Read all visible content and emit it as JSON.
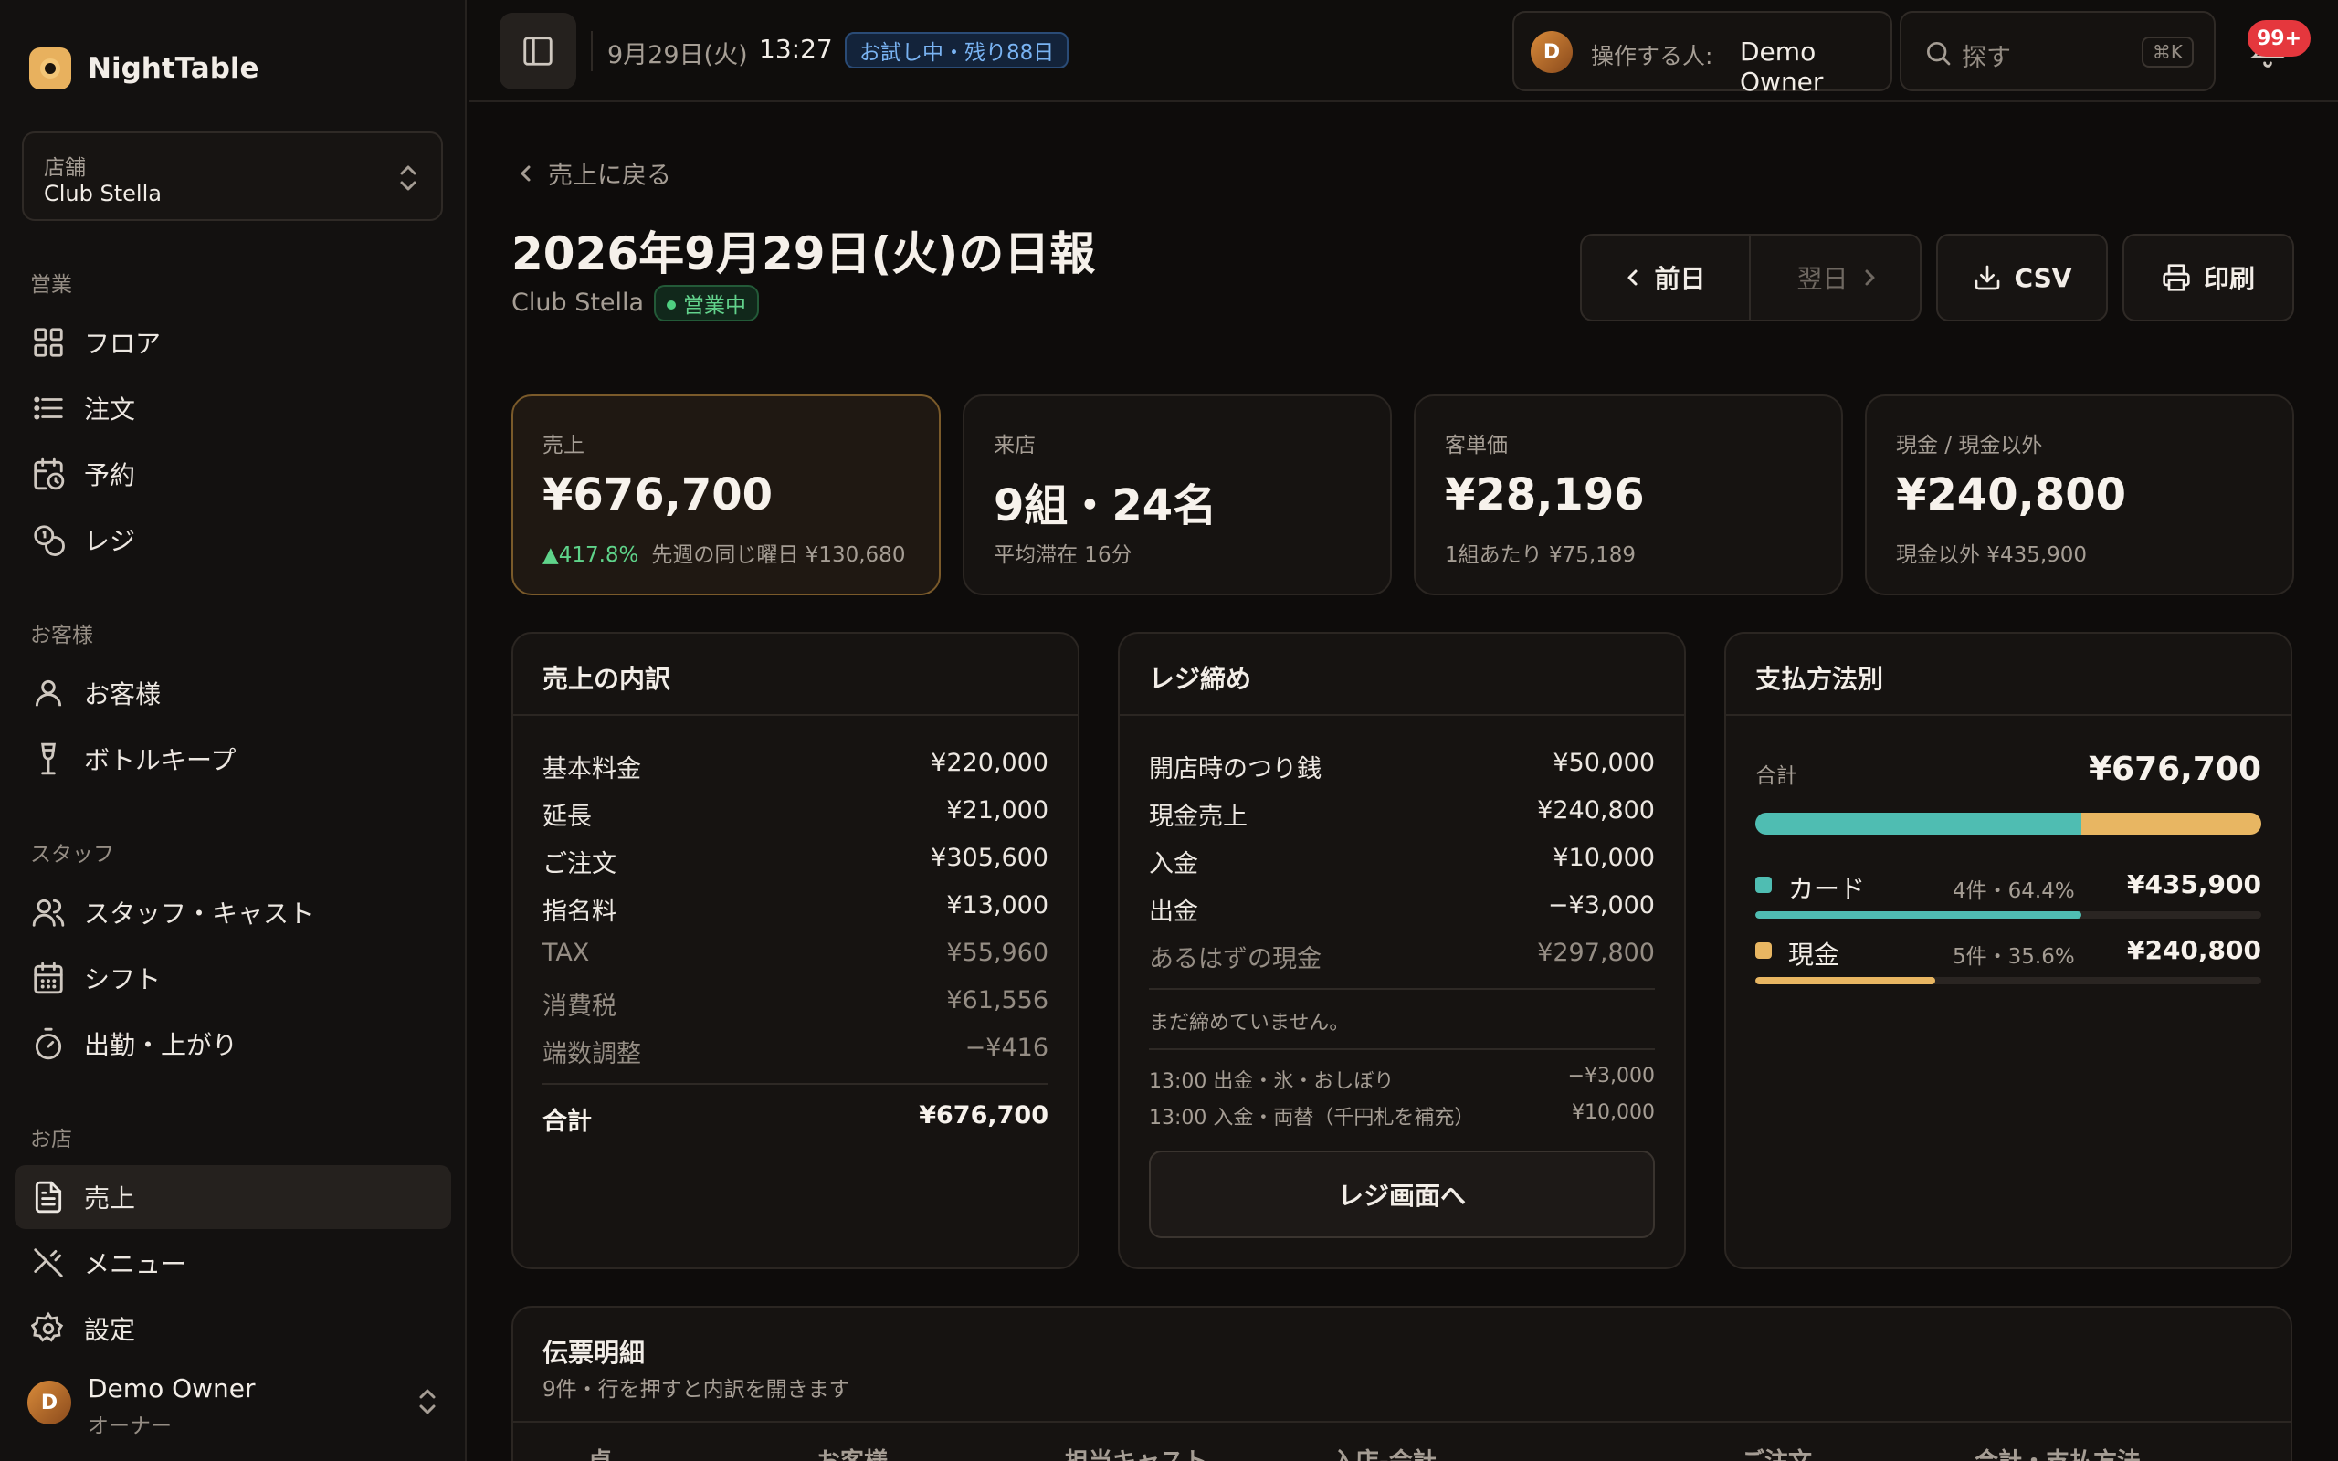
{
  "app": {
    "name": "NightTable"
  },
  "store": {
    "label": "店舗",
    "value": "Club Stella"
  },
  "nav": {
    "sections": {
      "business": "営業",
      "customers": "お客様",
      "staff": "スタッフ",
      "shop": "お店"
    },
    "items": [
      {
        "label": "フロア",
        "icon": "grid-icon"
      },
      {
        "label": "注文",
        "icon": "list-icon"
      },
      {
        "label": "予約",
        "icon": "calendar-clock-icon"
      },
      {
        "label": "レジ",
        "icon": "coins-icon"
      },
      {
        "label": "お客様",
        "icon": "user-icon"
      },
      {
        "label": "ボトルキープ",
        "icon": "wine-glass-icon"
      },
      {
        "label": "スタッフ・キャスト",
        "icon": "users-icon"
      },
      {
        "label": "シフト",
        "icon": "calendar-icon"
      },
      {
        "label": "出勤・上がり",
        "icon": "timer-icon"
      },
      {
        "label": "売上",
        "icon": "document-icon",
        "active": true
      },
      {
        "label": "メニュー",
        "icon": "utensils-icon"
      },
      {
        "label": "設定",
        "icon": "gear-icon"
      }
    ]
  },
  "user": {
    "initial": "D",
    "name": "Demo Owner",
    "role": "オーナー"
  },
  "topbar": {
    "date": "9月29日(火)",
    "time": "13:27",
    "trial": "お試し中・残り88日",
    "operator_label": "操作する人:",
    "operator_name": "Demo Owner",
    "operator_initial": "D",
    "search_placeholder": "探す",
    "search_shortcut": "⌘K",
    "notifications": "99+"
  },
  "page": {
    "back": "売上に戻る",
    "title": "2026年9月29日(火)の日報",
    "store": "Club Stella",
    "status": "営業中",
    "prev": "前日",
    "next": "翌日",
    "csv": "CSV",
    "print": "印刷"
  },
  "kpis": {
    "sales": {
      "label": "売上",
      "value": "¥676,700",
      "change": "▲417.8%",
      "compare": "先週の同じ曜日 ¥130,680"
    },
    "visits": {
      "label": "来店",
      "value": "9組・24名",
      "sub": "平均滞在 16分"
    },
    "avg": {
      "label": "客単価",
      "value": "¥28,196",
      "sub": "1組あたり ¥75,189"
    },
    "cash": {
      "label": "現金 / 現金以外",
      "value": "¥240,800",
      "sub": "現金以外 ¥435,900"
    }
  },
  "breakdown": {
    "title": "売上の内訳",
    "rows": [
      {
        "k": "基本料金",
        "v": "¥220,000"
      },
      {
        "k": "延長",
        "v": "¥21,000"
      },
      {
        "k": "ご注文",
        "v": "¥305,600"
      },
      {
        "k": "指名料",
        "v": "¥13,000"
      },
      {
        "k": "TAX",
        "v": "¥55,960"
      },
      {
        "k": "消費税",
        "v": "¥61,556"
      },
      {
        "k": "端数調整",
        "v": "−¥416"
      }
    ],
    "total_label": "合計",
    "total_value": "¥676,700"
  },
  "register": {
    "title": "レジ締め",
    "rows": [
      {
        "k": "開店時のつり銭",
        "v": "¥50,000"
      },
      {
        "k": "現金売上",
        "v": "¥240,800"
      },
      {
        "k": "入金",
        "v": "¥10,000"
      },
      {
        "k": "出金",
        "v": "−¥3,000"
      },
      {
        "k": "あるはずの現金",
        "v": "¥297,800"
      }
    ],
    "note": "まだ締めていません。",
    "log": [
      {
        "k": "13:00 出金・氷・おしぼり",
        "v": "−¥3,000"
      },
      {
        "k": "13:00 入金・両替（千円札を補充）",
        "v": "¥10,000"
      }
    ],
    "button": "レジ画面へ"
  },
  "payments": {
    "title": "支払方法別",
    "total_label": "合計",
    "total_value": "¥676,700",
    "methods": [
      {
        "name": "カード",
        "meta": "4件・64.4%",
        "amount": "¥435,900",
        "share": 0.644,
        "color": "#4fbdb2"
      },
      {
        "name": "現金",
        "meta": "5件・35.6%",
        "amount": "¥240,800",
        "share": 0.356,
        "color": "#e8b662"
      }
    ]
  },
  "slips": {
    "title": "伝票明細",
    "sub": "9件・行を押すと内訳を開きます",
    "columns": [
      "卓",
      "お客様",
      "担当キャスト",
      "入店-会計",
      "ご注文",
      "合計・支払方法"
    ]
  }
}
